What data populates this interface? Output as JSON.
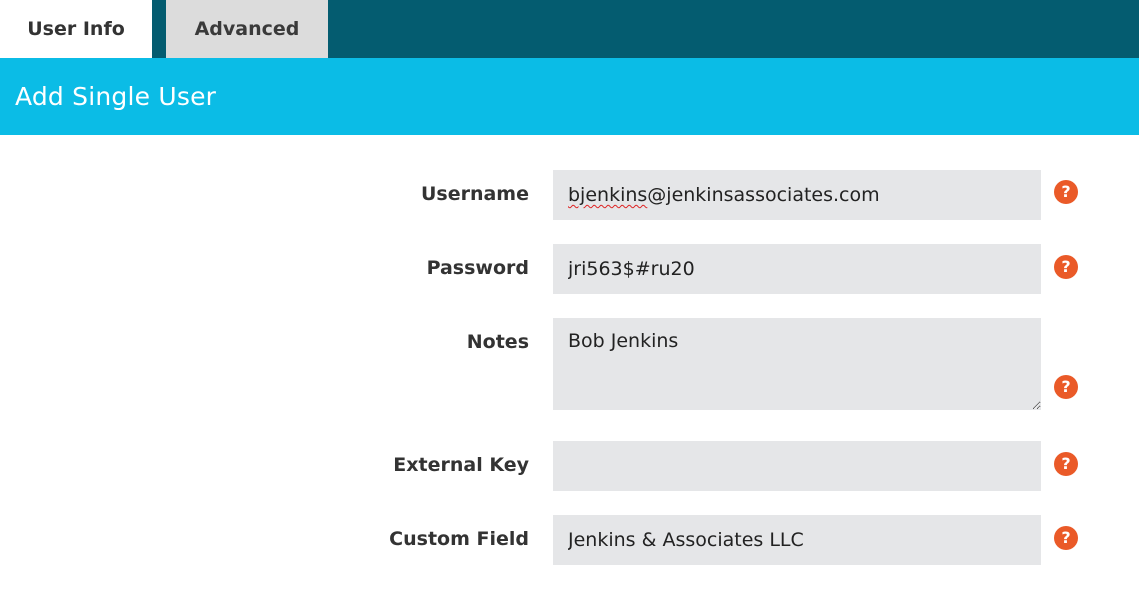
{
  "tabs": [
    {
      "label": "User Info",
      "active": true
    },
    {
      "label": "Advanced",
      "active": false
    }
  ],
  "header": {
    "title": "Add Single User"
  },
  "form": {
    "username": {
      "label": "Username",
      "value_misspelled": "bjenkins",
      "value_rest": "@jenkinsassociates.com"
    },
    "password": {
      "label": "Password",
      "value": "jri563$#ru20"
    },
    "notes": {
      "label": "Notes",
      "value": "Bob Jenkins"
    },
    "external_key": {
      "label": "External Key",
      "value": ""
    },
    "custom_field": {
      "label": "Custom Field",
      "value": "Jenkins & Associates LLC"
    },
    "help_icon_glyph": "?"
  },
  "colors": {
    "tabbar": "#045c70",
    "header": "#0bbce6",
    "field_bg": "#e5e6e8",
    "help_icon": "#ea5a28"
  }
}
